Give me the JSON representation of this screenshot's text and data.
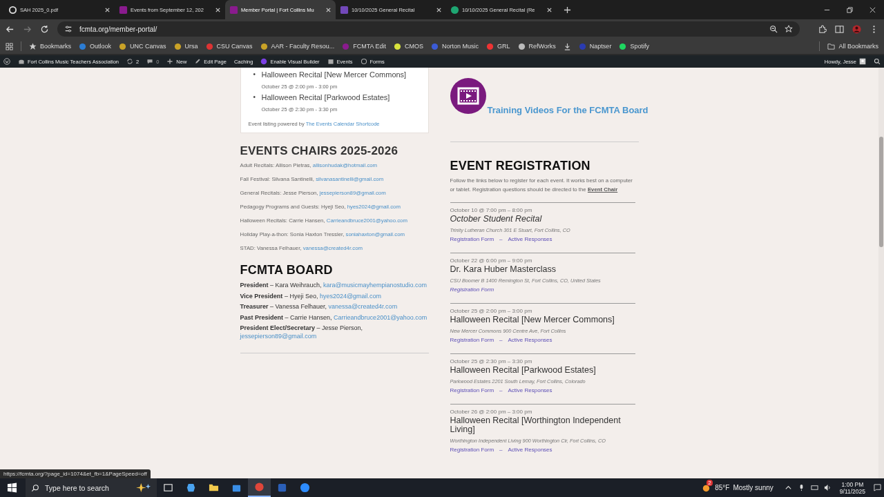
{
  "tabs": [
    {
      "title": "SAH 2025_0.pdf",
      "kind": "pdf",
      "selected": false
    },
    {
      "title": "Events from September 12, 202",
      "kind": "site",
      "selected": false
    },
    {
      "title": "Member Portal | Fort Collins Mu",
      "kind": "site",
      "selected": true
    },
    {
      "title": "10/10/2025 General Recital",
      "kind": "form",
      "selected": false
    },
    {
      "title": "10/10/2025 General Recital (Re",
      "kind": "globe",
      "selected": false
    }
  ],
  "address": {
    "url": "fcmta.org/member-portal/"
  },
  "bookmarks": [
    {
      "label": "Bookmarks",
      "kind": "star"
    },
    {
      "label": "Outlook",
      "kind": "mail"
    },
    {
      "label": "UNC Canvas",
      "kind": "shield"
    },
    {
      "label": "Ursa",
      "kind": "shield"
    },
    {
      "label": "CSU Canvas",
      "kind": "ring"
    },
    {
      "label": "AAR - Faculty Resou...",
      "kind": "shield"
    },
    {
      "label": "FCMTA Edit",
      "kind": "site"
    },
    {
      "label": "CMOS",
      "kind": "letter"
    },
    {
      "label": "Norton Music",
      "kind": "wave"
    },
    {
      "label": "GRL",
      "kind": "square"
    },
    {
      "label": "RefWorks",
      "kind": "globe"
    },
    {
      "kind": "download"
    },
    {
      "label": "Naptser",
      "kind": "circle"
    },
    {
      "label": "Spotify",
      "kind": "spotify"
    }
  ],
  "all_bookmarks": "All Bookmarks",
  "admin_bar": {
    "site": "Fort Collins Music Teachers Association",
    "updates": "2",
    "comments": "0",
    "items": [
      {
        "label": "New",
        "kind": "plus"
      },
      {
        "label": "Edit Page",
        "kind": "pencil"
      },
      {
        "label": "Caching"
      },
      {
        "label": "Enable Visual Builder",
        "kind": "builder"
      },
      {
        "label": "Events",
        "kind": "calendar"
      },
      {
        "label": "Forms",
        "kind": "forms"
      }
    ],
    "greeting": "Howdy, Jesse"
  },
  "upcoming": {
    "marker": "•",
    "events": [
      {
        "title": "Halloween Recital [New Mercer Commons]",
        "time": "October 25 @ 2:00 pm - 3:00 pm"
      },
      {
        "title": "Halloween Recital [Parkwood Estates]",
        "time": "October 25 @ 2:30 pm - 3:30 pm"
      }
    ],
    "footer": "Event listing powered by",
    "footer_link": "The Events Calendar Shortcode"
  },
  "chairs": {
    "heading": "EVENTS CHAIRS 2025-2026",
    "rows": [
      {
        "text": "Adult Recitals: Allison Pietras,",
        "email": "allisonhudak@hotmail.com"
      },
      {
        "text": "Fall Festival: Silvana Santinelli,",
        "email": "silvanasantinelli@gmail.com"
      },
      {
        "text": "General Recitals: Jesse Pierson,",
        "email": "jessepierson89@gmail.com"
      },
      {
        "text": "Pedagogy Programs and Guests: Hyeji Seo,",
        "email": "hyes2024@gmail.com"
      },
      {
        "text": "Halloween Recitals: Carrie Hansen,",
        "email": "Carrieandbruce2001@yahoo.com"
      },
      {
        "text": "Holiday Play-a-thon: Sonia Haxton Tressler,",
        "email": "soniahaxton@gmail.com"
      },
      {
        "text": "STAD: Vanessa Felhauer,",
        "email": "vanessa@created4r.com"
      }
    ]
  },
  "board": {
    "heading": "FCMTA BOARD",
    "rows": [
      {
        "text": "**President** – Kara Weihrauch,",
        "email": "kara@musicmayhempianostudio.com"
      },
      {
        "text": "**Vice President** – Hyeji Seo,",
        "email": "hyes2024@gmail.com"
      },
      {
        "text": "**Treasurer** – Vanessa Felhauer,",
        "email": "vanessa@created4r.com"
      },
      {
        "text": "**Past President** – Carrie Hansen,",
        "email": "Carrieandbruce2001@yahoo.com"
      },
      {
        "text": "**President Elect/Secretary** – Jesse Pierson,",
        "email": "jessepierson89@gmail.com"
      }
    ]
  },
  "training": {
    "link": "Training Videos For the FCMTA Board"
  },
  "registration": {
    "heading": "EVENT REGISTRATION",
    "intro": "Follow the links below to register for each event. It works best on a computer or tablet. Registration questions should be directed to the",
    "intro_link": "Event Chair",
    "events": [
      {
        "when": "October 10 @ 7:00 pm – 8:00 pm",
        "title": "October Student Recital",
        "italic": true,
        "venue": "Trinity Lutheran Church 301 E Stuart, Fort Collins, CO",
        "links": [
          "Registration Form",
          "Active Responses"
        ],
        "separator": "–"
      },
      {
        "when": "October 22 @ 6:00 pm – 9:00 pm",
        "title": "Dr. Kara Huber Masterclass",
        "italic": false,
        "venue": "CSU Boomer B 1400 Remington St, Fort Collins, CO, United States",
        "links": [
          "Registration Form"
        ]
      },
      {
        "when": "October 25 @ 2:00 pm – 3:00 pm",
        "title": "Halloween Recital [New Mercer Commons]",
        "italic": false,
        "venue": "New Mercer Commons 900 Centre Ave, Fort Collins",
        "links": [
          "Registration Form",
          "Active Responses"
        ],
        "separator": "–"
      },
      {
        "when": "October 25 @ 2:30 pm – 3:30 pm",
        "title": "Halloween Recital [Parkwood Estates]",
        "italic": false,
        "venue": "Parkwood Estates 2201 South Lemay, Fort Collins, Colorado",
        "links": [
          "Registration Form",
          "Active Responses"
        ],
        "separator": "–"
      },
      {
        "when": "October 26 @ 2:00 pm – 3:00 pm",
        "title": "Halloween Recital [Worthington Independent Living]",
        "italic": false,
        "venue": "Worthington Independent Living 900 Worthington Cir, Fort Collins, CO",
        "links": [
          "Registration Form",
          "Active Responses"
        ],
        "separator": "–"
      }
    ]
  },
  "status_url": "https://fcmta.org/?page_id=1074&et_fb=1&PageSpeed=off",
  "taskbar": {
    "search_placeholder": "Type here to search",
    "apps": [
      {
        "kind": "taskview",
        "selected": false
      },
      {
        "kind": "copilot",
        "selected": false
      },
      {
        "kind": "folder",
        "selected": false
      },
      {
        "kind": "store",
        "selected": false
      },
      {
        "kind": "chrome",
        "selected": true
      },
      {
        "kind": "word",
        "selected": false
      },
      {
        "kind": "zoom",
        "selected": false
      }
    ],
    "weather": "85°F",
    "weather_text": "Mostly sunny",
    "weather_badge": "2",
    "time": "1:00 PM",
    "date": "9/11/2025"
  }
}
